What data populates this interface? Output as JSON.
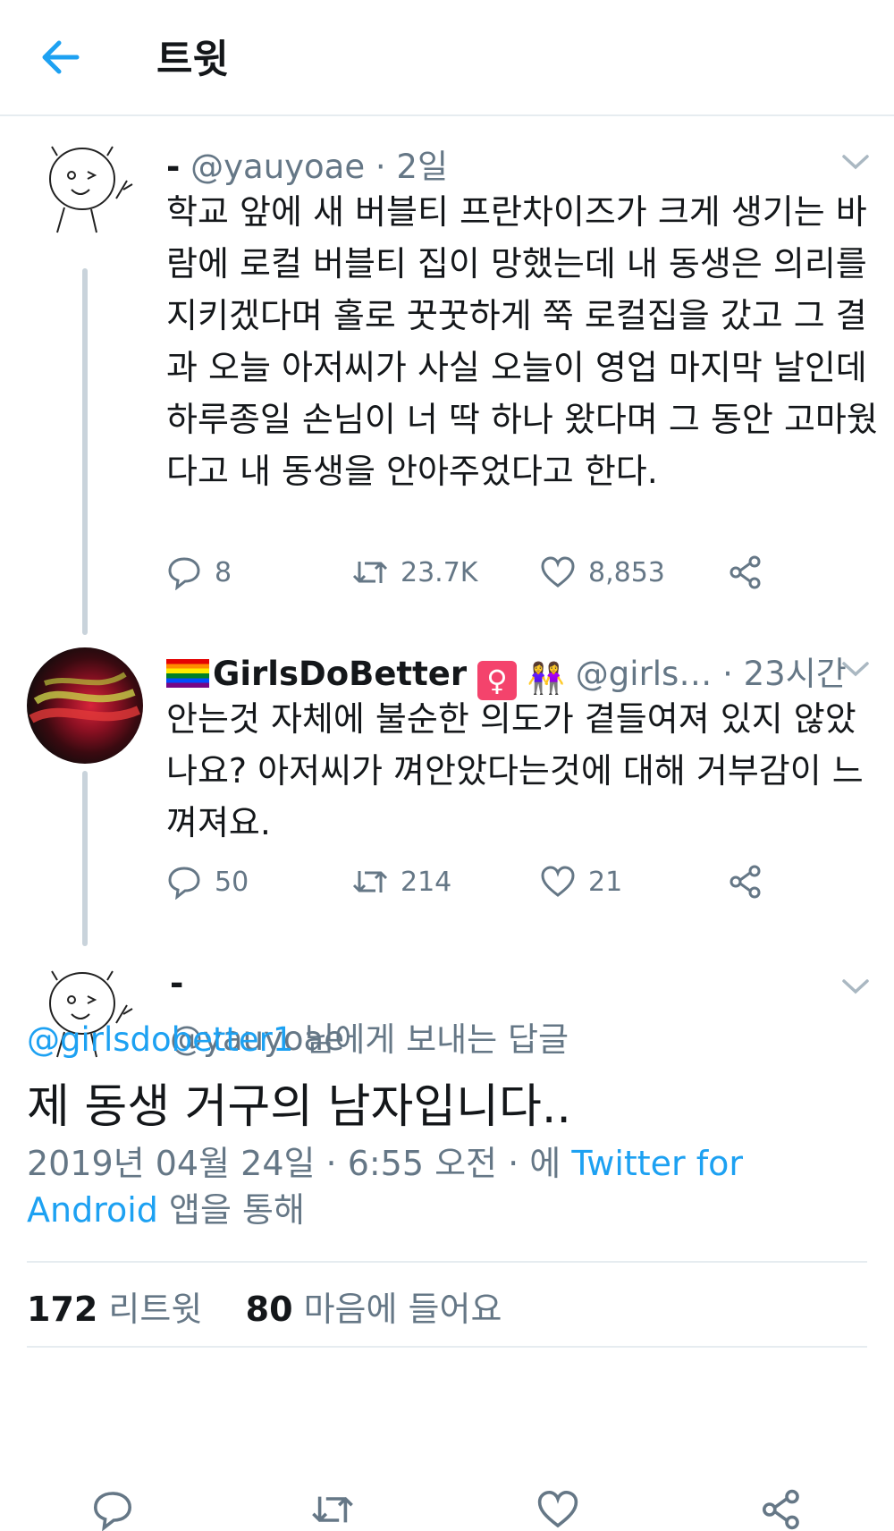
{
  "header": {
    "title": "트윗"
  },
  "tweets": [
    {
      "name": "-",
      "handle": "@yauyoae",
      "time": "· 2일",
      "text": "학교 앞에 새 버블티 프란차이즈가 크게 생기는 바람에 로컬 버블티 집이 망했는데 내 동생은 의리를 지키겠다며 홀로 꿋꿋하게 쭉 로컬집을 갔고 그 결과 오늘 아저씨가 사실 오늘이 영업 마지막 날인데 하루종일 손님이 너 딱 하나 왔다며 그 동안 고마웠다고 내 동생을 안아주었다고 한다.",
      "replies": "8",
      "retweets": "23.7K",
      "likes": "8,853"
    },
    {
      "name": "GirlsDoBetter",
      "emoji_box": "♀",
      "emoji_girls": "👭",
      "handle": "@girls…",
      "time": "· 23시간",
      "text": "안는것 자체에 불순한 의도가 곁들여져 있지 않았나요? 아저씨가 껴안았다는것에 대해 거부감이 느껴져요.",
      "replies": "50",
      "retweets": "214",
      "likes": "21"
    }
  ],
  "main_tweet": {
    "name": "-",
    "handle": "@yauyoae",
    "reply_to_link": "@girlsdobetter1",
    "reply_to_suffix": " 님에게 보내는 답글",
    "text": "제 동생 거구의 남자입니다..",
    "datetime": "2019년 04월 24일 · 6:55 오전 · 에 ",
    "client_link": "Twitter for Android",
    "client_suffix": " 앱을 통해",
    "retweet_count": "172",
    "retweet_label": " 리트윗",
    "like_count": "80",
    "like_label": " 마음에 들어요"
  },
  "icons": [
    "back-arrow-icon",
    "chevron-down-icon",
    "reply-icon",
    "retweet-icon",
    "heart-icon",
    "share-icon",
    "rainbow-flag-icon"
  ],
  "colors": {
    "accent": "#1da1f2",
    "secondary_text": "#657786",
    "divider": "#e6ecf0",
    "primary_text": "#14171a"
  }
}
